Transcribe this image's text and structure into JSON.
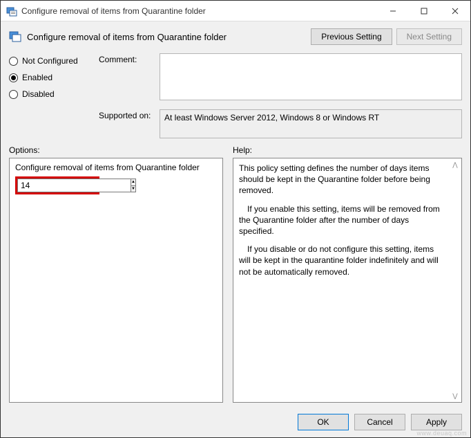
{
  "window": {
    "title": "Configure removal of items from Quarantine folder"
  },
  "header": {
    "title": "Configure removal of items from Quarantine folder",
    "prev": "Previous Setting",
    "next": "Next Setting"
  },
  "state": {
    "not_configured": "Not Configured",
    "enabled": "Enabled",
    "disabled": "Disabled",
    "selected": "enabled"
  },
  "fields": {
    "comment_label": "Comment:",
    "comment_value": "",
    "supported_label": "Supported on:",
    "supported_value": "At least Windows Server 2012, Windows 8 or Windows RT"
  },
  "sections": {
    "options": "Options:",
    "help": "Help:"
  },
  "options": {
    "title": "Configure removal of items from Quarantine folder",
    "spinner_value": "14"
  },
  "help": {
    "p1": "This policy setting defines the number of days items should be kept in the Quarantine folder before being removed.",
    "p2": "If you enable this setting, items will be removed from the Quarantine folder after the number of days specified.",
    "p3": "If you disable or do not configure this setting, items will be kept in the quarantine folder indefinitely and will not be automatically removed."
  },
  "footer": {
    "ok": "OK",
    "cancel": "Cancel",
    "apply": "Apply"
  },
  "watermark": "www.deuaq.com"
}
